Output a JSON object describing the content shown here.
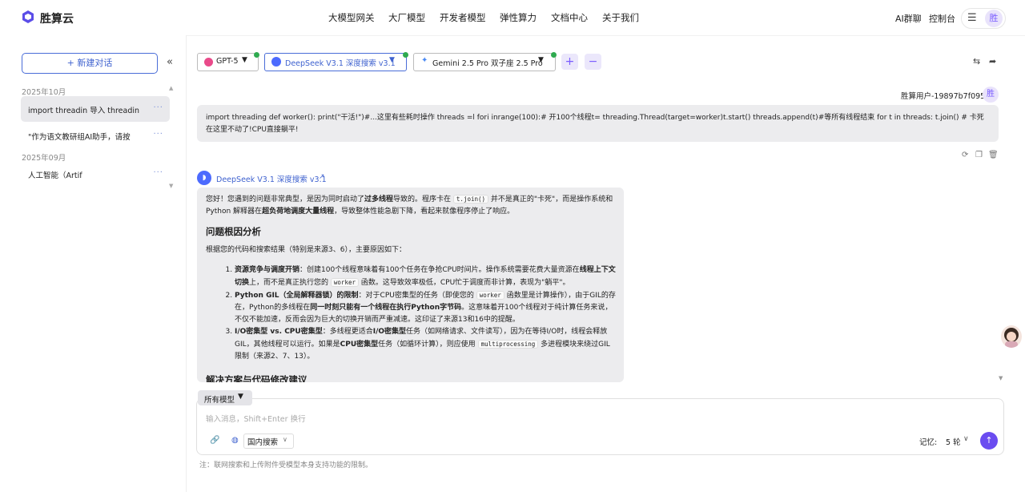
{
  "app": {
    "name": "胜算云"
  },
  "topnav": {
    "items": [
      "大模型网关",
      "大厂模型",
      "开发者模型",
      "弹性算力",
      "文档中心",
      "关于我们"
    ],
    "right_items": [
      "AI群聊",
      "控制台"
    ],
    "avatar_char": "胜"
  },
  "sidebar": {
    "new_chat_label": "+ 新建对话",
    "groups": [
      {
        "label": "2025年10月",
        "items": [
          {
            "title": "import threadin  导入 threadin",
            "active": true
          },
          {
            "title": "\"作为语文教研组AI助手，请按",
            "active": false
          }
        ]
      },
      {
        "label": "2025年09月",
        "items": [
          {
            "title": "人工智能（Artif",
            "active": false
          }
        ]
      }
    ],
    "dots": "···"
  },
  "models": [
    {
      "name": "GPT-5",
      "icon": "openai-icon",
      "color": "#e94a8a",
      "online": true
    },
    {
      "name": "DeepSeek V3.1   深度搜索 v3.1",
      "icon": "deepseek-icon",
      "color": "#4d6bfe",
      "online": true,
      "highlight": true
    },
    {
      "name": "Gemini 2.5 Pro   双子座 2.5 Pro",
      "icon": "gemini-icon",
      "color": "#4a8af4",
      "online": true
    }
  ],
  "chat": {
    "user_name": "胜算用户-19897b7f095",
    "user_avatar": "胜",
    "user_message": "import threading def worker(): print(\"干活!\")#...这里有些耗时操作 threads =l fori inrange(100):# 开100个线程t= threading.Thread(target=worker)t.start() threads.append(t)#等所有线程结束 for t in threads: t.join() # 卡死在这里不动了!CPU直接躺平!",
    "assistant_name": "DeepSeek V3.1   深度搜索 v3.1",
    "answer": {
      "intro_1": "您好！您遇到的问题非常典型，是因为同时启动了",
      "intro_bold_1": "过多线程",
      "intro_2": "导致的。程序卡在",
      "intro_code": "t.join()",
      "intro_3": "并不是真正的\"卡死\"，而是操作系统和 Python 解释器在",
      "intro_bold_2": "超负荷地调度大量线程",
      "intro_4": "，导致整体性能急剧下降，看起来就像程序停止了响应。",
      "heading_1": "问题根因分析",
      "lead": "根据您的代码和搜索结果（特别是来源3、6），主要原因如下：",
      "items": [
        {
          "bold": "资源竞争与调度开销",
          "t1": "：创建100个线程意味着有100个任务在争抢CPU时间片。操作系统需要花费大量资源在",
          "b2": "线程上下文切换",
          "t2": "上，而不是真正执行您的",
          "code": "worker",
          "t3": "函数。这导致效率极低，CPU忙于调度而非计算，表现为\"躺平\"。"
        },
        {
          "bold": "Python GIL（全局解释器锁）的限制",
          "t1": "：对于CPU密集型的任务（即使您的",
          "code": "worker",
          "t2": "函数里是计算操作），由于GIL的存在，Python的多线程在",
          "b2": "同一时刻只能有一个线程在执行Python字节码",
          "t3": "。这意味着开100个线程对于纯计算任务来说，不仅不能加速，反而会因为巨大的切换开销而严重减速。这印证了来源13和16中的提醒。"
        },
        {
          "bold": "I/O密集型 vs. CPU密集型",
          "t1": "：多线程更适合",
          "b2": "I/O密集型",
          "t2": "任务（如网络请求、文件读写），因为在等待I/O时，线程会释放GIL，其他线程可以运行。如果是",
          "b3": "CPU密集型",
          "t3": "任务（如循环计算），则应使用",
          "code": "multiprocessing",
          "t4": "多进程模块来绕过GIL限制（来源2、7、13）。"
        }
      ],
      "heading_2": "解决方案与代码修改建议"
    }
  },
  "input": {
    "model_filter": "所有模型",
    "placeholder": "输入消息，Shift+Enter 换行",
    "search_mode": "国内搜索",
    "memory_label": "记忆:",
    "memory_value": "5 轮",
    "footnote": "注：联网搜索和上传附件受模型本身支持功能的限制。"
  },
  "colors": {
    "accent": "#3f62cf",
    "send": "#6a4cf0",
    "online": "#2faa4f"
  }
}
